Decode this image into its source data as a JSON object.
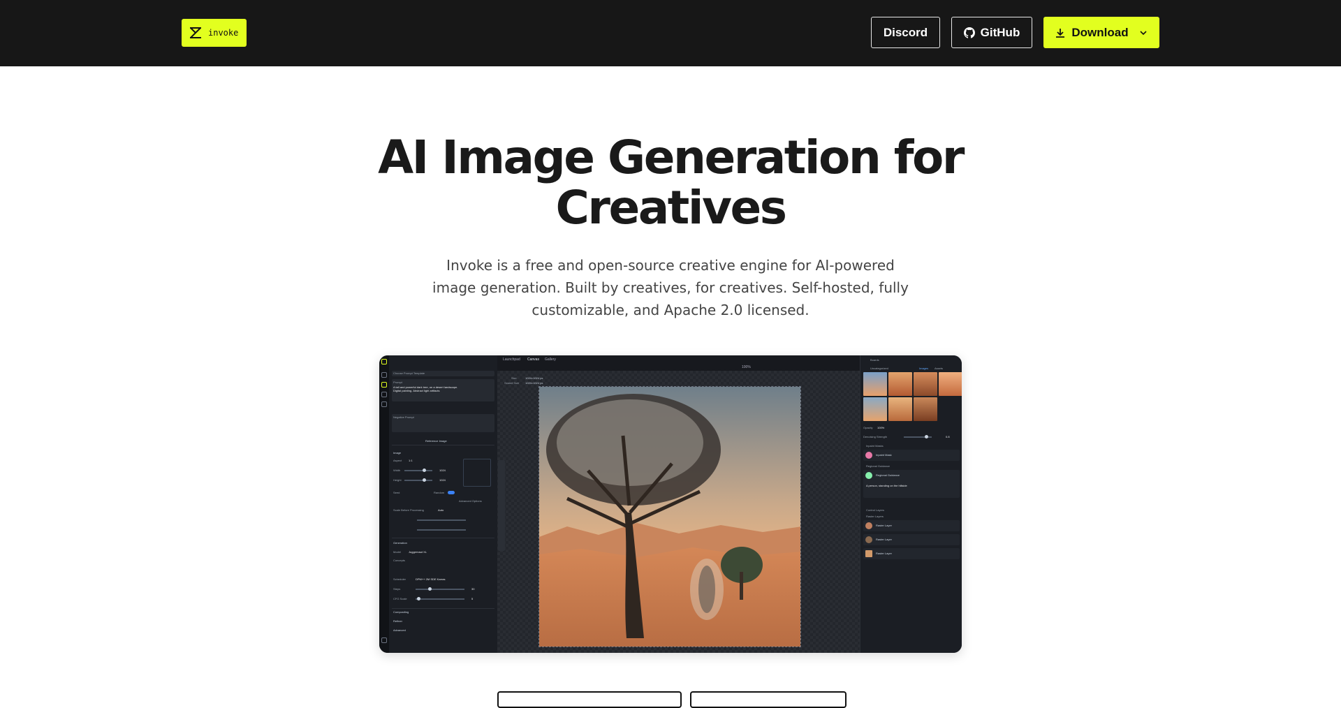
{
  "header": {
    "logo_text": "invoke",
    "discord_label": "Discord",
    "github_label": "GitHub",
    "download_label": "Download",
    "accent_color": "#e2ff1f",
    "background_color": "#171717"
  },
  "hero": {
    "title_line1": "AI Image Generation for",
    "title_line2": "Creatives",
    "subtitle": "Invoke is a free and open-source creative engine for AI-powered image generation. Built by creatives, for creatives. Self-hosted, fully customizable, and Apache 2.0 licensed."
  },
  "app": {
    "left_panel": {
      "template_label": "Choose Prompt Template",
      "prompt_label": "Prompt",
      "prompt_text": "A tall and powerful dark tree, on a desert landscape. Digital painting. Abstract light artifacts",
      "negative_prompt_label": "Negative Prompt",
      "reference_image_label": "Reference Image",
      "image_section": "Image",
      "aspect_label": "Aspect",
      "aspect_value": "1:1",
      "width_label": "Width",
      "width_value": "1024",
      "height_label": "Height",
      "height_value": "1024",
      "seed_label": "Seed",
      "random_label": "Random",
      "advanced_options": "Advanced Options",
      "scale_label": "Scale Before Processing",
      "scale_value": "Auto",
      "generation_section": "Generation",
      "model_label": "Model",
      "model_value": "Juggernaut XL",
      "concepts_label": "Concepts",
      "scheduler_label": "Scheduler",
      "scheduler_value": "DPM++ 2M SDE Karras",
      "steps_label": "Steps",
      "steps_value": "30",
      "cfg_label": "CFG Scale",
      "cfg_value": "5",
      "compositing": "Compositing",
      "refiner": "Refiner",
      "advanced": "Advanced"
    },
    "canvas": {
      "tab_launchpad": "Launchpad",
      "tab_canvas": "Canvas",
      "tab_gallery": "Gallery",
      "zoom": "100%",
      "size_label": "Size",
      "size_value": "1024×1024 px",
      "scaled_label": "Scaled Size",
      "scaled_value": "1024×1024 px"
    },
    "right_panel": {
      "boards_label": "Boards",
      "uncategorized_label": "Uncategorized",
      "images_tab": "Images",
      "assets_tab": "Assets",
      "opacity_label": "Opacity",
      "opacity_value": "100%",
      "denoise_label": "Denoising Strength",
      "denoise_value": "0.8",
      "inpaint_group": "Inpaint Masks",
      "inpaint_mask": "Inpaint Mask",
      "regional_group": "Regional Guidance",
      "regional_label": "Regional Guidance",
      "regional_prompt": "A person, standing on the hillside",
      "control_group": "Control Layers",
      "raster_group": "Raster Layers",
      "raster_1": "Raster Layer",
      "raster_2": "Raster Layer",
      "raster_3": "Raster Layer"
    }
  }
}
